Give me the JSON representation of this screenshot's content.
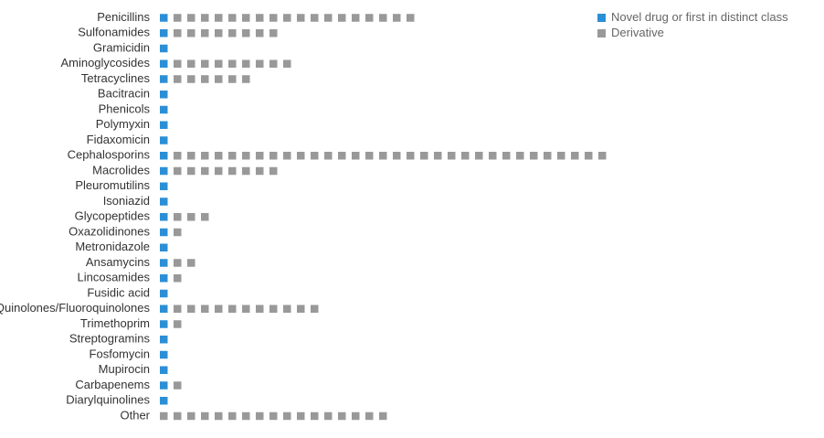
{
  "chart_data": {
    "type": "bar",
    "categories": [
      "Penicillins",
      "Sulfonamides",
      "Gramicidin",
      "Aminoglycosides",
      "Tetracyclines",
      "Bacitracin",
      "Phenicols",
      "Polymyxin",
      "Fidaxomicin",
      "Cephalosporins",
      "Macrolides",
      "Pleuromutilins",
      "Isoniazid",
      "Glycopeptides",
      "Oxazolidinones",
      "Metronidazole",
      "Ansamycins",
      "Lincosamides",
      "Fusidic acid",
      "Quinolones/Fluoroquinolones",
      "Trimethoprim",
      "Streptogramins",
      "Fosfomycin",
      "Mupirocin",
      "Carbapenems",
      "Diarylquinolines",
      "Other"
    ],
    "series": [
      {
        "name": "Novel drug or first in distinct class",
        "color": "#2b8fd6",
        "values": [
          1,
          1,
          1,
          1,
          1,
          1,
          1,
          1,
          1,
          1,
          1,
          1,
          1,
          1,
          1,
          1,
          1,
          1,
          1,
          1,
          1,
          1,
          1,
          1,
          1,
          1,
          0
        ]
      },
      {
        "name": "Derivative",
        "color": "#999999",
        "values": [
          18,
          8,
          0,
          9,
          6,
          0,
          0,
          0,
          0,
          32,
          8,
          0,
          0,
          3,
          1,
          0,
          2,
          1,
          0,
          11,
          1,
          0,
          0,
          0,
          1,
          0,
          17
        ]
      }
    ],
    "legend_position": "top-right",
    "grid": false
  }
}
